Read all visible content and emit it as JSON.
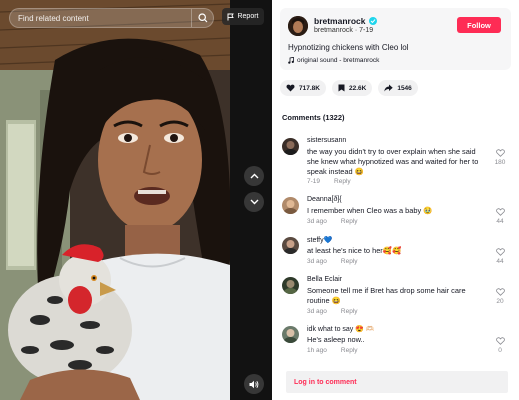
{
  "search": {
    "placeholder": "Find related content"
  },
  "report": {
    "label": "Report"
  },
  "post": {
    "username": "bretmanrock",
    "handle": "bretmanrock",
    "date": "7-19",
    "caption": "Hypnotizing chickens with Cleo lol",
    "sound": "original sound - bretmanrock",
    "follow_label": "Follow"
  },
  "stats": {
    "likes": "717.8K",
    "saves": "22.6K",
    "shares": "1546"
  },
  "comments_header": "Comments (1322)",
  "comments": [
    {
      "user": "sistersusann",
      "text": "the way you didn't try to over explain when she said she knew what hypnotized was and waited for her to speak instead 😆",
      "date": "7-19",
      "reply": "Reply",
      "likes": "180",
      "avatar_color": "#3a2e28"
    },
    {
      "user": "Deanna[ð]{",
      "text": "I remember when Cleo was a baby 🥹",
      "date": "3d ago",
      "reply": "Reply",
      "likes": "44",
      "avatar_color": "#b08a6a"
    },
    {
      "user": "steffy💙",
      "text": "at least he's nice to her🥰🥰",
      "date": "3d ago",
      "reply": "Reply",
      "likes": "44",
      "avatar_color": "#5a4a40"
    },
    {
      "user": "Bella Eclair",
      "text": "Someone tell me if Bret has drop some hair care routine 😆",
      "date": "3d ago",
      "reply": "Reply",
      "likes": "20",
      "avatar_color": "#2e3a2a"
    },
    {
      "user": "idk what to say 😍 🫶🏻",
      "text": "He's asleep now..",
      "date": "1h ago",
      "reply": "Reply",
      "likes": "0",
      "avatar_color": "#6a7a6a"
    }
  ],
  "login_label": "Log in to comment",
  "colors": {
    "accent": "#fe2c55",
    "verified": "#20d5ec",
    "text": "#161823",
    "muted": "#8a8b91"
  }
}
